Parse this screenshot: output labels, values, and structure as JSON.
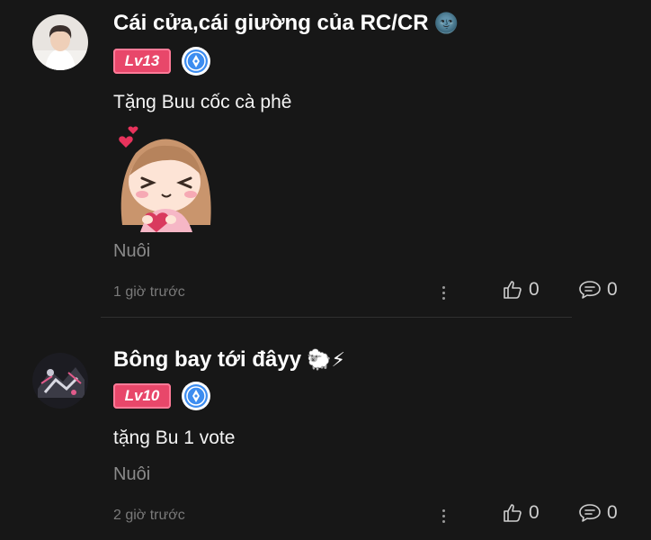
{
  "comments": [
    {
      "author": "Cái cửa,cái giường của RC/CR",
      "name_emoji": "🌚",
      "level": "Lv13",
      "text": "Tặng Buu cốc cà phê",
      "category": "Nuôi",
      "time": "1 giờ trước",
      "likes": "0",
      "replies": "0"
    },
    {
      "author": "Bông bay tới đâyy",
      "name_emoji": "🐑⚡",
      "level": "Lv10",
      "text": "tặng Bu 1 vote",
      "category": "Nuôi",
      "time": "2 giờ trước",
      "likes": "0",
      "replies": "0"
    }
  ],
  "colors": {
    "background": "#171717",
    "level_badge": "#e8476a",
    "pen_badge": "#3d8df0",
    "muted_text": "#8a8a8a"
  },
  "icons": [
    "more-vertical-icon",
    "thumb-up-icon",
    "comment-bubble-icon",
    "pen-badge-icon"
  ]
}
